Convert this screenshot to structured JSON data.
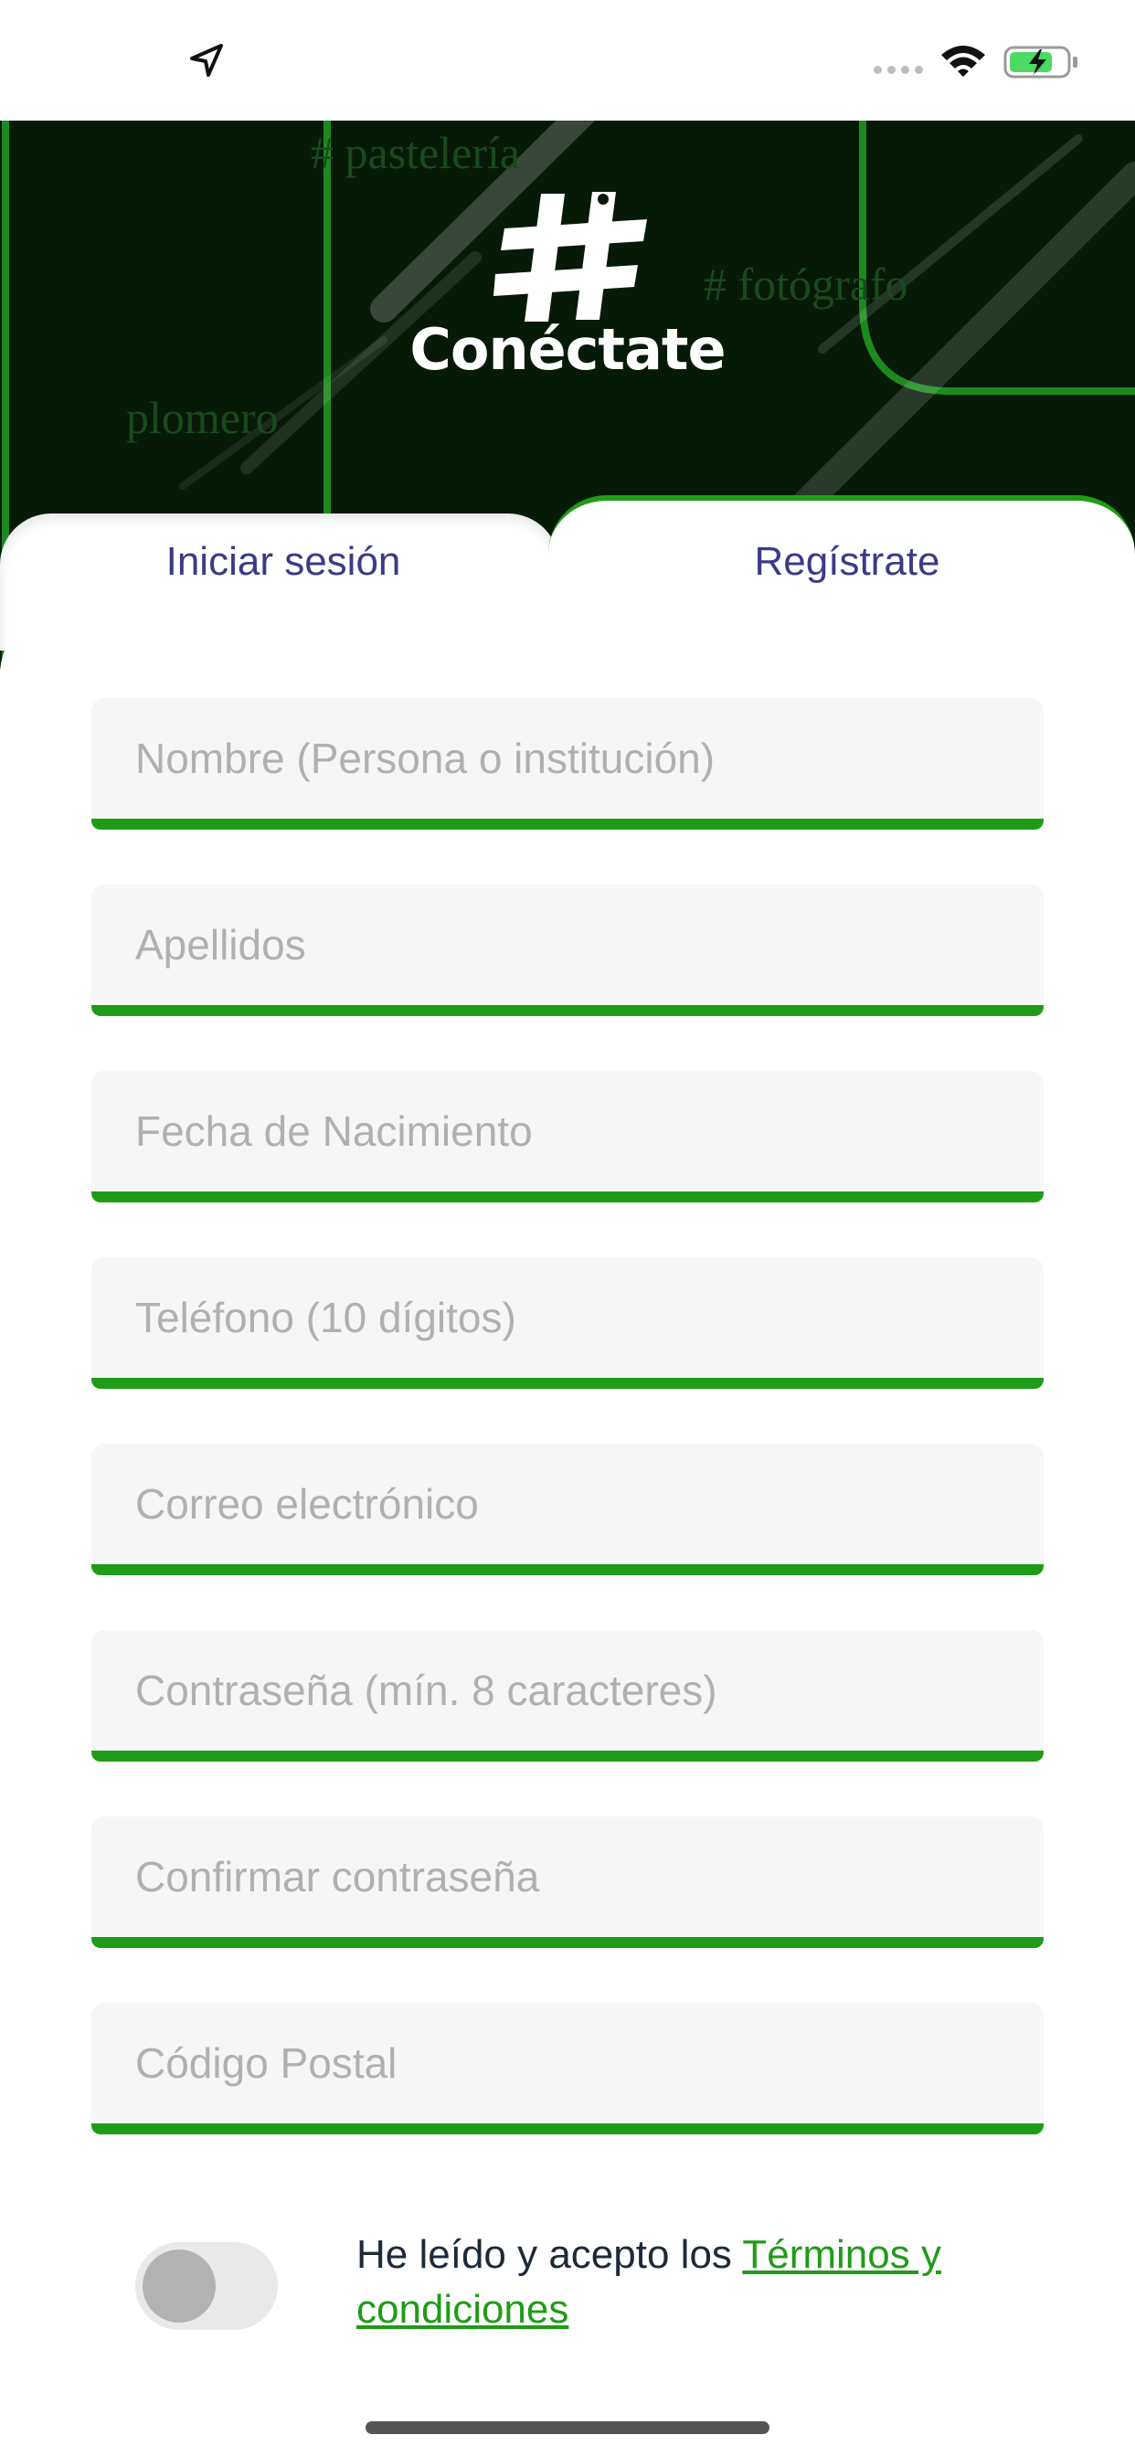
{
  "hero": {
    "background_words": [
      "# pastelería",
      "# fotógrafo",
      "plomero"
    ],
    "logo_symbol": "#",
    "logo_text": "Conéctate"
  },
  "tabs": [
    {
      "label": "Iniciar sesión",
      "active": false
    },
    {
      "label": "Regístrate",
      "active": true
    }
  ],
  "form": {
    "fields": [
      {
        "placeholder": "Nombre (Persona o institución)",
        "value": ""
      },
      {
        "placeholder": "Apellidos",
        "value": ""
      },
      {
        "placeholder": "Fecha de Nacimiento",
        "value": ""
      },
      {
        "placeholder": "Teléfono (10 dígitos)",
        "value": ""
      },
      {
        "placeholder": "Correo electrónico",
        "value": ""
      },
      {
        "placeholder": "Contraseña (mín. 8 caracteres)",
        "value": ""
      },
      {
        "placeholder": "Confirmar contraseña",
        "value": ""
      },
      {
        "placeholder": "Código Postal",
        "value": ""
      }
    ]
  },
  "terms": {
    "toggle_on": false,
    "text": "He leído y acepto los ",
    "link_text": "Términos y condiciones"
  },
  "colors": {
    "accent_green": "#1f9c17",
    "tab_text": "#3d3a85",
    "hero_background": "#071a08"
  }
}
